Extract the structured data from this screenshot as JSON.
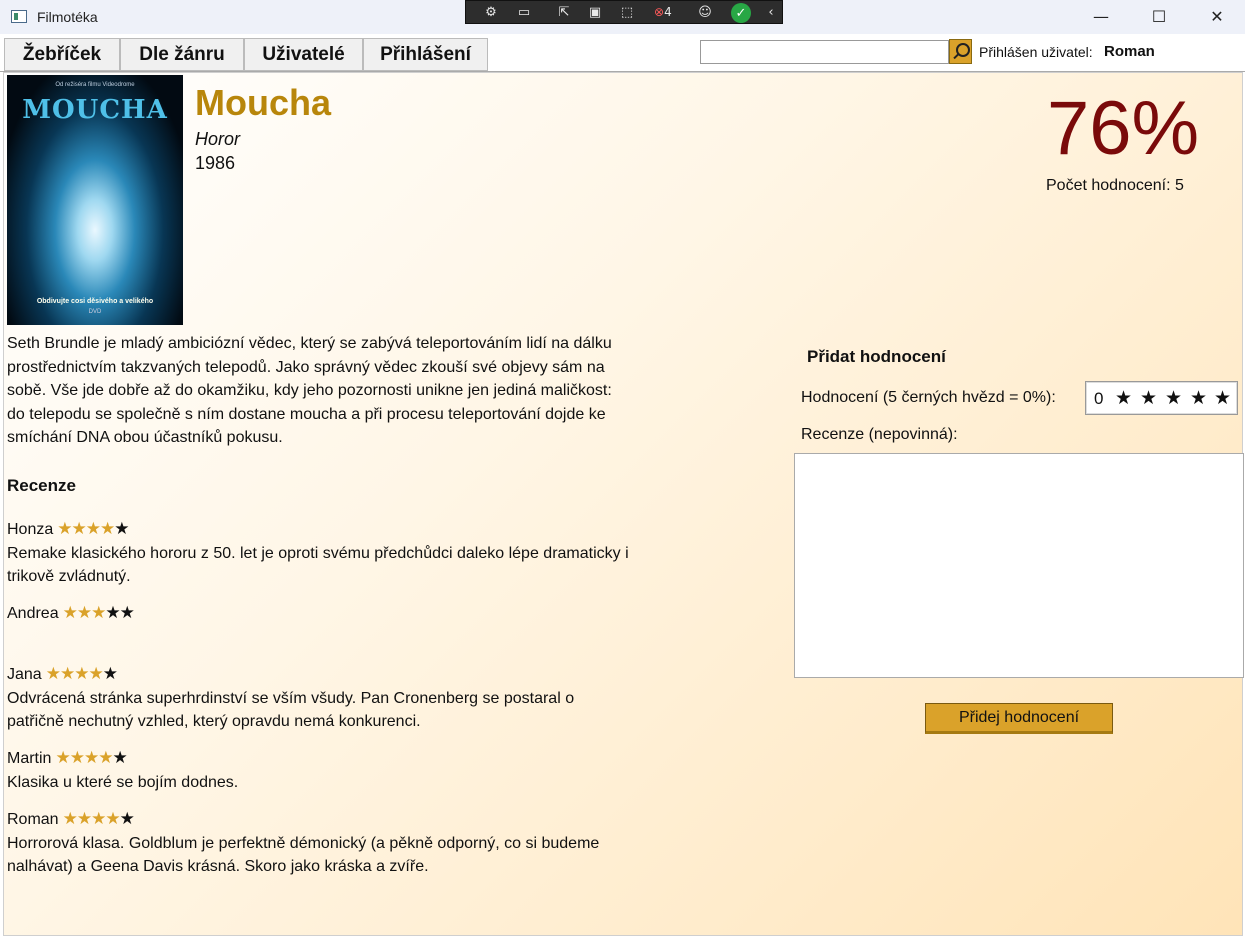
{
  "window": {
    "title": "Filmotéka",
    "controls": {
      "minimize": "—",
      "maximize": "☐",
      "close": "✕"
    }
  },
  "debug_toolbar": {
    "badge_count": "4"
  },
  "menu": {
    "tabs": [
      "Žebříček",
      "Dle žánru",
      "Uživatelé",
      "Přihlášení"
    ]
  },
  "search": {
    "value": "",
    "placeholder": ""
  },
  "user": {
    "label": "Přihlášen uživatel:",
    "name": "Roman"
  },
  "movie": {
    "title": "Moucha",
    "genre": "Horor",
    "year": "1986",
    "rating_percent": "76%",
    "rating_count": "Počet hodnocení: 5",
    "poster": {
      "title": "MOUCHA",
      "tagline": "Obdivujte cosi děsivého a velikého",
      "top_text": "Od režiséra filmu Videodrome",
      "dvd_mark": "DVD"
    },
    "description": "Seth Brundle je mladý ambiciózní vědec, který se zabývá teleportováním lidí na dálku prostřednictvím takzvaných telepodů. Jako správný vědec zkouší své objevy sám na sobě. Vše jde dobře až do okamžiku, kdy jeho pozornosti unikne jen jediná maličkost: do telepodu se společně s ním dostane moucha a při procesu teleportování dojde ke smíchání DNA obou účastníků pokusu."
  },
  "reviews": {
    "heading": "Recenze",
    "items": [
      {
        "author": "Honza",
        "stars": 4,
        "text": "Remake klasického hororu z 50. let je oproti svému předchůdci daleko lépe dramaticky i trikově zvládnutý."
      },
      {
        "author": "Andrea",
        "stars": 3,
        "text": ""
      },
      {
        "author": "Jana",
        "stars": 4,
        "text": "Odvrácená stránka superhrdinství se vším všudy. Pan Cronenberg se postaral o patřičně nechutný vzhled, který opravdu nemá konkurenci."
      },
      {
        "author": "Martin",
        "stars": 4,
        "text": "Klasika u které se bojím dodnes."
      },
      {
        "author": "Roman",
        "stars": 4,
        "text": "Horrorová klasa. Goldblum je perfektně démonický (a pěkně odporný, co si budeme nalhávat) a Geena Davis krásná. Skoro jako kráska a zvíře."
      }
    ]
  },
  "add_review": {
    "heading": "Přidat hodnocení",
    "rating_label": "Hodnocení (5 černých hvězd = 0%):",
    "rating_value": "0",
    "max_stars": 5,
    "review_label": "Recenze (nepovinná):",
    "review_value": "",
    "submit_label": "Přidej hodnocení"
  },
  "colors": {
    "accent": "#daa22a",
    "title": "#b8860b",
    "rating": "#7a0a0a"
  }
}
